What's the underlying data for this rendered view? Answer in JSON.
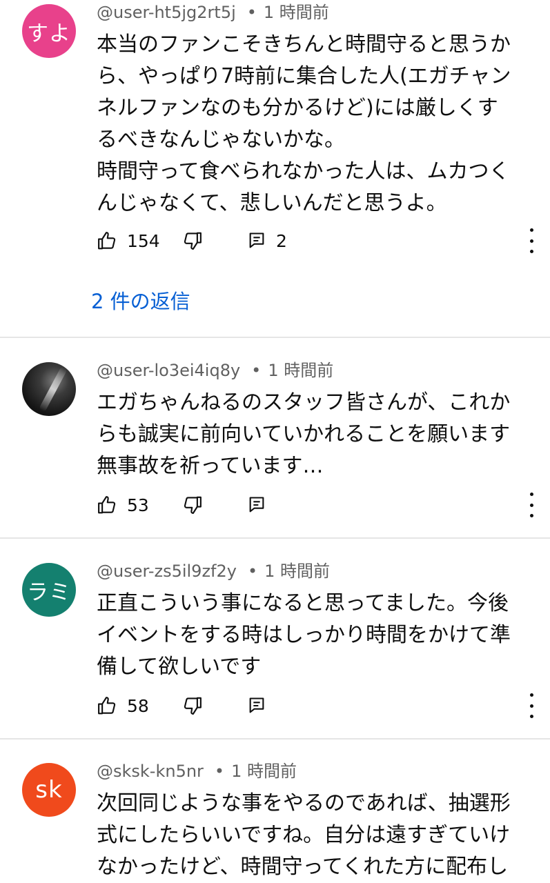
{
  "comments": [
    {
      "avatar_text": "すよ",
      "avatar_color": "#e8418b",
      "author": "@user-ht5jg2rt5j",
      "time": "1 時間前",
      "lines": [
        "本当のファンこそきちんと時間守ると思うか",
        "ら、やっぱり7時前に集合した人(エガチャン",
        "ネルファンなのも分かるけど)には厳しくす",
        "るべきなんじゃないかな。",
        "時間守って食べられなかった人は、ムカつく",
        "んじゃなくて、悲しいんだと思うよ。"
      ],
      "likes": "154",
      "replies_count": "2",
      "replies_label": "2 件の返信"
    },
    {
      "avatar_text": "",
      "avatar_color": "#1a1a1a",
      "author": "@user-lo3ei4iq8y",
      "time": "1 時間前",
      "lines": [
        "エガちゃんねるのスタッフ皆さんが、これか",
        "らも誠実に前向いていかれることを願います",
        "無事故を祈っています…"
      ],
      "likes": "53"
    },
    {
      "avatar_text": "ラミ",
      "avatar_color": "#14806f",
      "author": "@user-zs5il9zf2y",
      "time": "1 時間前",
      "lines": [
        "正直こういう事になると思ってました。今後",
        "イベントをする時はしっかり時間をかけて準",
        "備して欲しいです"
      ],
      "likes": "58"
    },
    {
      "avatar_text": "sk",
      "avatar_color": "#f04a1c",
      "author": "@sksk-kn5nr",
      "time": "1 時間前",
      "lines": [
        "次回同じような事をやるのであれば、抽選形",
        "式にしたらいいですね。自分は遠すぎていけ",
        "なかったけど、時間守ってくれた方に配布し"
      ]
    }
  ],
  "colors": {
    "link": "#065fd4",
    "meta_text": "#606060",
    "divider": "#e5e5e5"
  },
  "icons": [
    "like-icon",
    "dislike-icon",
    "reply-icon",
    "more-options-icon"
  ]
}
